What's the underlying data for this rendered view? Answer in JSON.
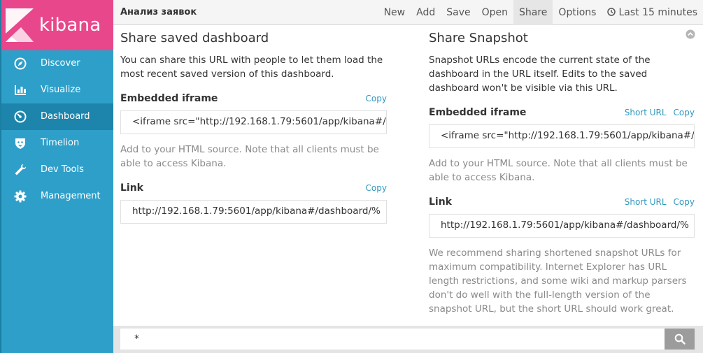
{
  "app": {
    "logo_text": "kibana"
  },
  "sidebar": {
    "items": [
      {
        "label": "Discover",
        "icon": "compass-icon"
      },
      {
        "label": "Visualize",
        "icon": "bar-chart-icon"
      },
      {
        "label": "Dashboard",
        "icon": "dashboard-icon",
        "active": true
      },
      {
        "label": "Timelion",
        "icon": "timelion-icon"
      },
      {
        "label": "Dev Tools",
        "icon": "wrench-icon"
      },
      {
        "label": "Management",
        "icon": "gear-icon"
      }
    ]
  },
  "topbar": {
    "title": "Анализ заявок",
    "menu": {
      "new": "New",
      "add": "Add",
      "save": "Save",
      "open": "Open",
      "share": "Share",
      "options": "Options",
      "time": "Last 15 minutes"
    },
    "active_menu": "share"
  },
  "share_saved": {
    "title": "Share saved dashboard",
    "description": "You can share this URL with people to let them load the most recent saved version of this dashboard.",
    "embed_label": "Embedded iframe",
    "embed_copy": "Copy",
    "embed_value": "<iframe src=\"http://192.168.1.79:5601/app/kibana#/",
    "embed_hint": "Add to your HTML source. Note that all clients must be able to access Kibana.",
    "link_label": "Link",
    "link_copy": "Copy",
    "link_value": "http://192.168.1.79:5601/app/kibana#/dashboard/%"
  },
  "share_snapshot": {
    "title": "Share Snapshot",
    "description": "Snapshot URLs encode the current state of the dashboard in the URL itself. Edits to the saved dashboard won't be visible via this URL.",
    "embed_label": "Embedded iframe",
    "embed_short_url": "Short URL",
    "embed_copy": "Copy",
    "embed_value": "<iframe src=\"http://192.168.1.79:5601/app/kibana#/",
    "embed_hint": "Add to your HTML source. Note that all clients must be able to access Kibana.",
    "link_label": "Link",
    "link_short_url": "Short URL",
    "link_copy": "Copy",
    "link_value": "http://192.168.1.79:5601/app/kibana#/dashboard/%",
    "recommendation": "We recommend sharing shortened snapshot URLs for maximum compatibility. Internet Explorer has URL length restrictions, and some wiki and markup parsers don't do well with the full-length version of the snapshot URL, but the short URL should work great."
  },
  "query": {
    "value": "*"
  },
  "colors": {
    "logo_bg": "#e8488b",
    "sidebar_bg": "#2e9fc9",
    "sidebar_active": "#1d84ab",
    "link": "#2f99c1"
  }
}
